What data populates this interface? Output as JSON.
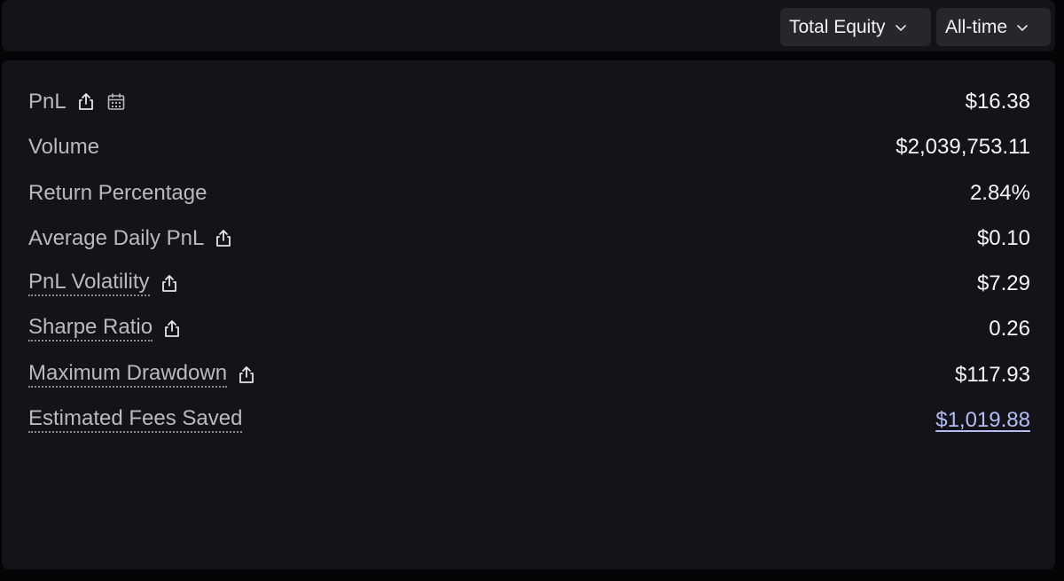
{
  "header": {
    "metric_select": {
      "value": "Total Equity",
      "icon": "chevron-down-icon"
    },
    "period_select": {
      "value": "All-time",
      "icon": "chevron-down-icon"
    }
  },
  "stats": {
    "pnl": {
      "label": "PnL",
      "value": "$16.38",
      "icons": [
        "share-icon",
        "calendar-icon"
      ]
    },
    "volume": {
      "label": "Volume",
      "value": "$2,039,753.11"
    },
    "return_percentage": {
      "label": "Return Percentage",
      "value": "2.84%"
    },
    "average_daily_pnl": {
      "label": "Average Daily PnL",
      "value": "$0.10",
      "icons": [
        "share-icon"
      ]
    },
    "pnl_volatility": {
      "label": "PnL Volatility",
      "value": "$7.29",
      "icons": [
        "share-icon"
      ]
    },
    "sharpe_ratio": {
      "label": "Sharpe Ratio",
      "value": "0.26",
      "icons": [
        "share-icon"
      ]
    },
    "maximum_drawdown": {
      "label": "Maximum Drawdown",
      "value": "$117.93",
      "icons": [
        "share-icon"
      ]
    },
    "estimated_fees_saved": {
      "label": "Estimated Fees Saved",
      "value": "$1,019.88"
    }
  },
  "colors": {
    "page_background": "#050507",
    "panel_background": "#141418",
    "dropdown_background": "#26262c",
    "label_text": "#b9b9bf",
    "value_text": "#f5f5f7",
    "link_value": "#b3bdf5"
  }
}
